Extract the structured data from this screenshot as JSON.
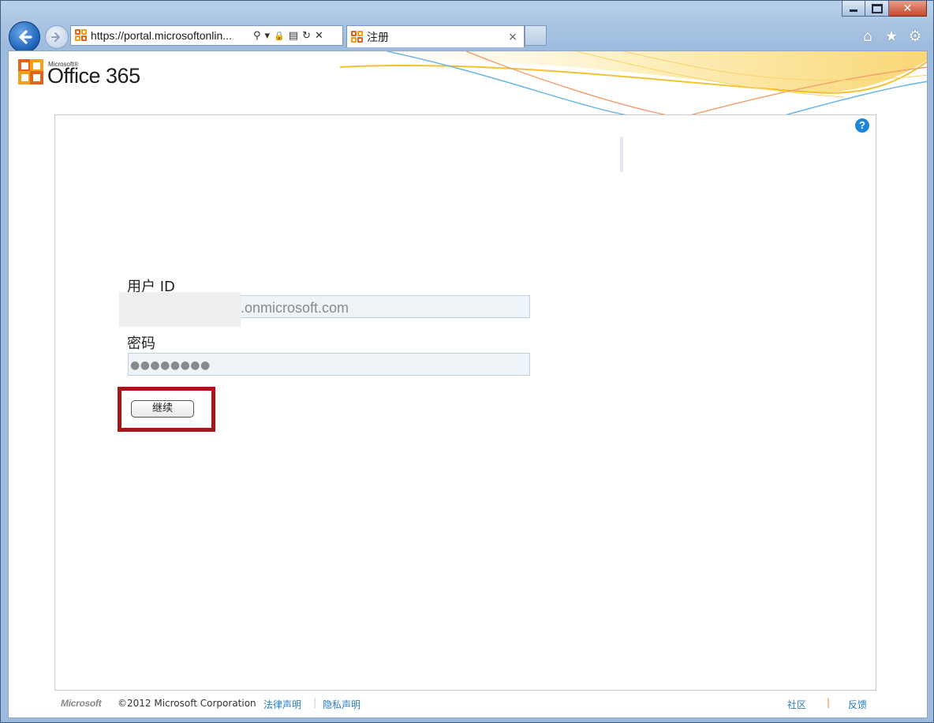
{
  "browser": {
    "address_url": "https://portal.microsoftonlin...",
    "tab_title": "注册",
    "tab_close": "×",
    "addr_icons": [
      "⚲",
      "▾",
      "🔒",
      "▤",
      "↻",
      "✕"
    ],
    "right_tools": [
      "⌂",
      "★",
      "⚙"
    ]
  },
  "window_controls": {
    "close": "✕"
  },
  "brand": {
    "small": "Microsoft®",
    "product": "Office 365"
  },
  "help": {
    "label": "?"
  },
  "form": {
    "userid_label": "用户 ID",
    "userid_value": ".onmicrosoft.com",
    "password_label": "密码",
    "password_value": "●●●●●●●●",
    "continue_label": "继续"
  },
  "footer": {
    "ms_logo": "Microsoft",
    "copyright": "©2012 Microsoft Corporation",
    "legal_link": "法律声明",
    "sep": "|",
    "privacy_link": "隐私声明",
    "community_link": "社区",
    "feedback_link": "反馈"
  },
  "colors": {
    "accent_blue": "#1d86d8",
    "link": "#2a7bbf",
    "highlight_red": "#a8161b",
    "office_orange": "#e2641c"
  }
}
